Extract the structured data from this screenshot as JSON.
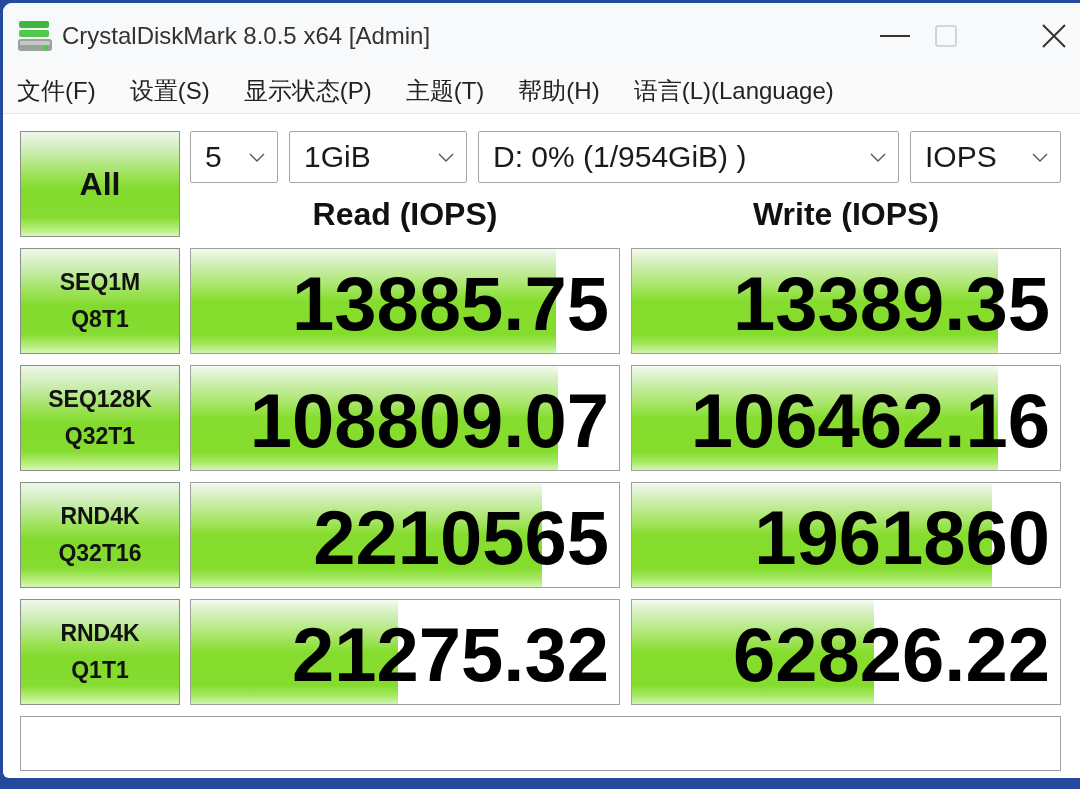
{
  "window": {
    "title": "CrystalDiskMark 8.0.5 x64 [Admin]",
    "controls": [
      {
        "kind": "minimize",
        "disabled": false
      },
      {
        "kind": "maximize",
        "disabled": true
      },
      {
        "kind": "close",
        "disabled": false
      }
    ]
  },
  "menu": [
    "文件(F)",
    "设置(S)",
    "显示状态(P)",
    "主题(T)",
    "帮助(H)",
    "语言(L)(Language)"
  ],
  "all_button": "All",
  "selects": [
    "5",
    "1GiB",
    "D: 0% (1/954GiB) )",
    "IOPS"
  ],
  "columns": [
    "Read (IOPS)",
    "Write (IOPS)"
  ],
  "rows": [
    {
      "label": [
        "SEQ1M",
        "Q8T1"
      ],
      "read": {
        "value": "13885.75",
        "level": 0.853
      },
      "write": {
        "value": "13389.35",
        "level": 0.856
      }
    },
    {
      "label": [
        "SEQ128K",
        "Q32T1"
      ],
      "read": {
        "value": "108809.07",
        "level": 0.858
      },
      "write": {
        "value": "106462.16",
        "level": 0.856
      }
    },
    {
      "label": [
        "RND4K",
        "Q32T16"
      ],
      "read": {
        "value": "2210565",
        "level": 0.819
      },
      "write": {
        "value": "1961860",
        "level": 0.842
      }
    },
    {
      "label": [
        "RND4K",
        "Q1T1"
      ],
      "read": {
        "value": "21275.32",
        "level": 0.484
      },
      "write": {
        "value": "62826.22",
        "level": 0.565
      }
    }
  ]
}
